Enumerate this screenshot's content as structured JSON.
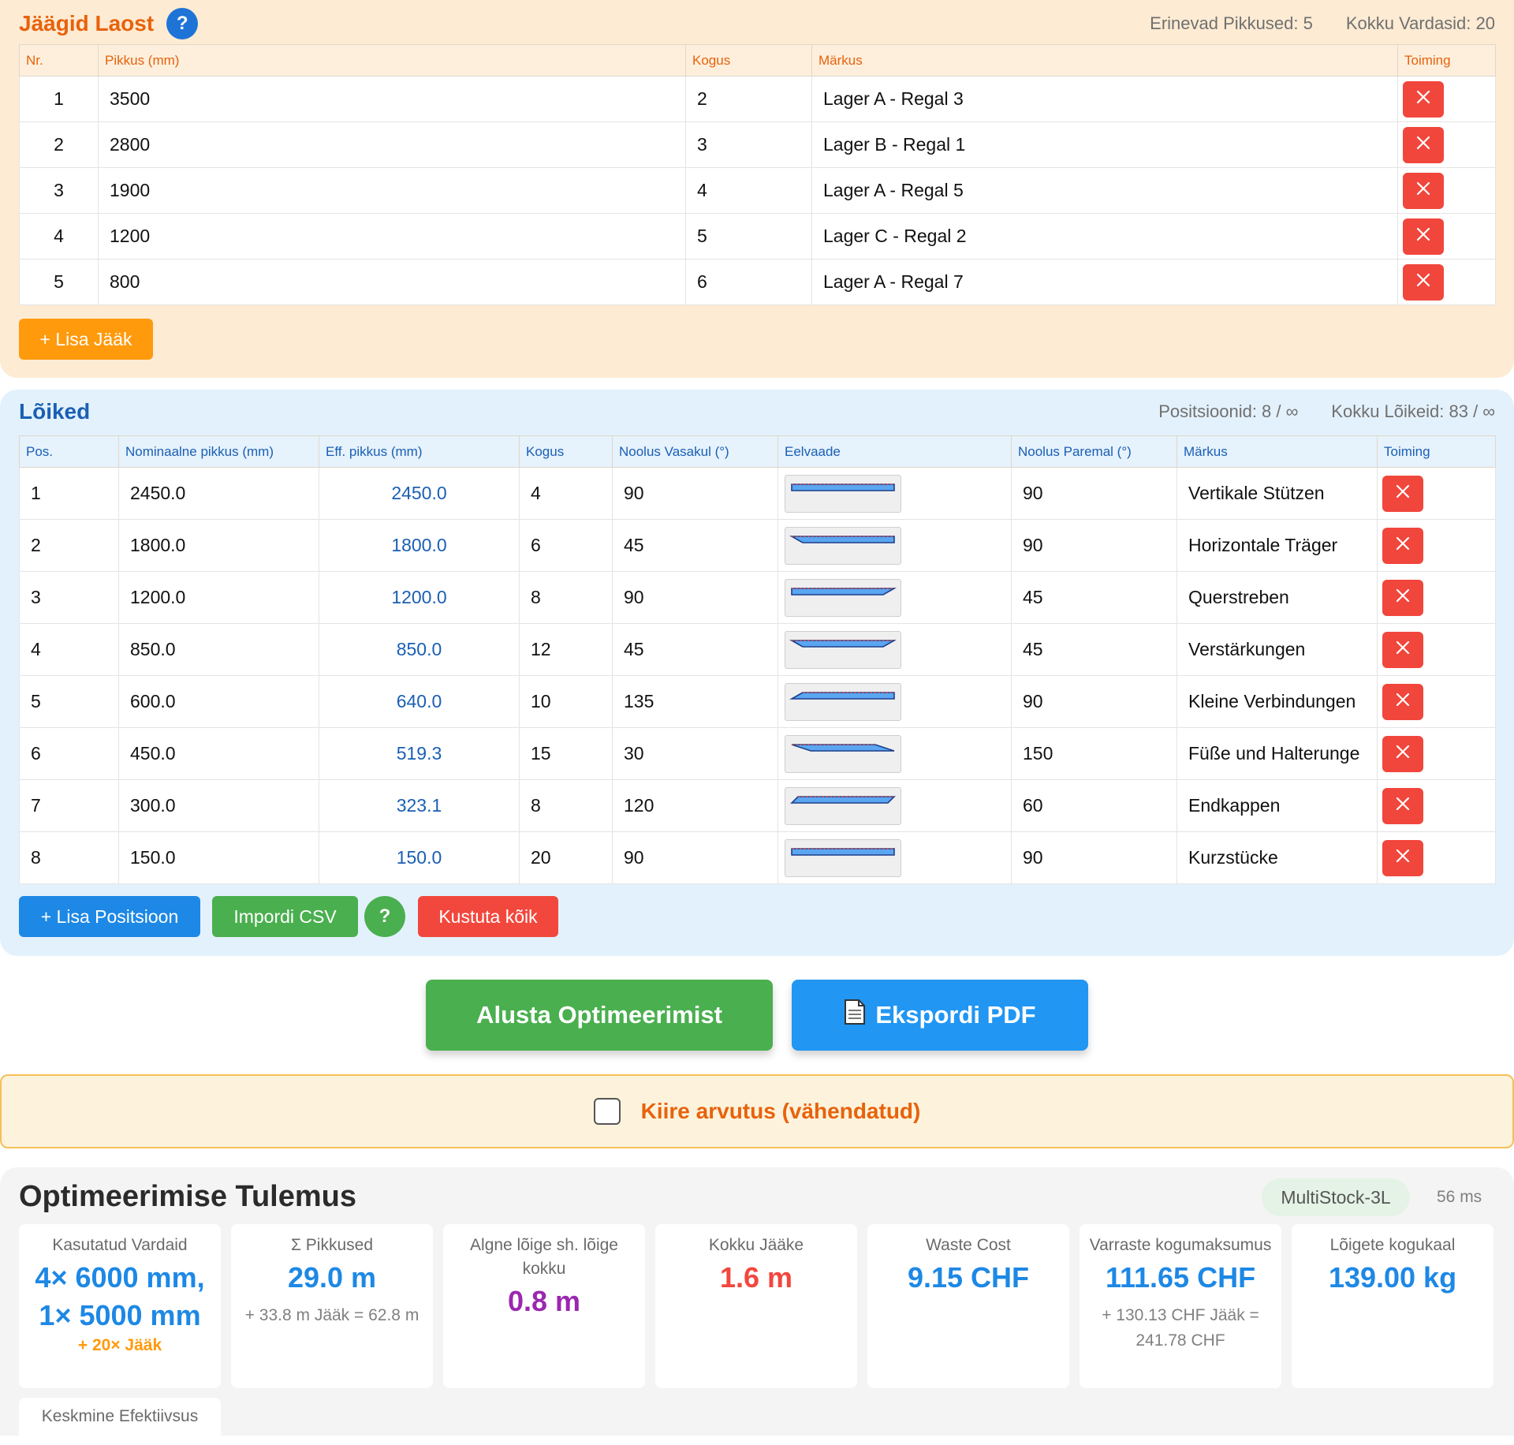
{
  "stock": {
    "title": "Jäägid Laost",
    "help": "?",
    "stat_lengths": "Erinevad Pikkused: 5",
    "stat_bars": "Kokku Vardasid: 20",
    "columns": [
      "Nr.",
      "Pikkus (mm)",
      "Kogus",
      "Märkus",
      "Toiming"
    ],
    "rows": [
      {
        "nr": "1",
        "length": "3500",
        "qty": "2",
        "note": "Lager A - Regal 3"
      },
      {
        "nr": "2",
        "length": "2800",
        "qty": "3",
        "note": "Lager B - Regal 1"
      },
      {
        "nr": "3",
        "length": "1900",
        "qty": "4",
        "note": "Lager A - Regal 5"
      },
      {
        "nr": "4",
        "length": "1200",
        "qty": "5",
        "note": "Lager C - Regal 2"
      },
      {
        "nr": "5",
        "length": "800",
        "qty": "6",
        "note": "Lager A - Regal 7"
      }
    ],
    "add_button": "+ Lisa Jääk"
  },
  "cuts": {
    "title": "Lõiked",
    "stat_positions": "Positsioonid: 8 / ∞",
    "stat_cuts": "Kokku Lõikeid: 83 / ∞",
    "columns": [
      "Pos.",
      "Nominaalne pikkus (mm)",
      "Eff. pikkus (mm)",
      "Kogus",
      "Noolus Vasakul (°)",
      "Eelvaade",
      "Noolus Paremal (°)",
      "Märkus",
      "Toiming"
    ],
    "rows": [
      {
        "pos": "1",
        "nominal": "2450.0",
        "eff": "2450.0",
        "qty": "4",
        "left": "90",
        "right": "90",
        "note": "Vertikale Stützen"
      },
      {
        "pos": "2",
        "nominal": "1800.0",
        "eff": "1800.0",
        "qty": "6",
        "left": "45",
        "right": "90",
        "note": "Horizontale Träger"
      },
      {
        "pos": "3",
        "nominal": "1200.0",
        "eff": "1200.0",
        "qty": "8",
        "left": "90",
        "right": "45",
        "note": "Querstreben"
      },
      {
        "pos": "4",
        "nominal": "850.0",
        "eff": "850.0",
        "qty": "12",
        "left": "45",
        "right": "45",
        "note": "Verstärkungen"
      },
      {
        "pos": "5",
        "nominal": "600.0",
        "eff": "640.0",
        "qty": "10",
        "left": "135",
        "right": "90",
        "note": "Kleine Verbindungen"
      },
      {
        "pos": "6",
        "nominal": "450.0",
        "eff": "519.3",
        "qty": "15",
        "left": "30",
        "right": "150",
        "note": "Füße und Halterunge"
      },
      {
        "pos": "7",
        "nominal": "300.0",
        "eff": "323.1",
        "qty": "8",
        "left": "120",
        "right": "60",
        "note": "Endkappen"
      },
      {
        "pos": "8",
        "nominal": "150.0",
        "eff": "150.0",
        "qty": "20",
        "left": "90",
        "right": "90",
        "note": "Kurzstücke"
      }
    ],
    "add_button": "+ Lisa Positsioon",
    "import_button": "Impordi CSV",
    "help": "?",
    "delete_all_button": "Kustuta kõik"
  },
  "actions": {
    "optimize_button": "Alusta Optimeerimist",
    "export_button": "Ekspordi PDF",
    "export_icon": "document-icon"
  },
  "quick_calc": {
    "label": "Kiire arvutus (vähendatud)",
    "checked": false
  },
  "results": {
    "title": "Optimeerimise Tulemus",
    "algorithm": "MultiStock-3L",
    "timing": "56 ms",
    "cards": [
      {
        "label": "Kasutatud Vardaid",
        "value": "4× 6000 mm, 1× 5000 mm",
        "extra": "+ 20× Jääk"
      },
      {
        "label": "Σ Pikkused",
        "value": "29.0 m",
        "sub": "+ 33.8 m Jääk = 62.8 m"
      },
      {
        "label": "Algne lõige sh. lõige kokku",
        "value": "0.8 m"
      },
      {
        "label": "Kokku Jääke",
        "value": "1.6 m"
      },
      {
        "label": "Waste Cost",
        "value": "9.15 CHF"
      },
      {
        "label": "Varraste kogumaksumus",
        "value": "111.65 CHF",
        "sub": "+ 130.13 CHF Jääk = 241.78 CHF"
      },
      {
        "label": "Lõigete kogukaal",
        "value": "139.00 kg"
      },
      {
        "label": "Keskmine Efektiivsus"
      }
    ]
  },
  "colors": {
    "stock_accent": "#e8620c",
    "cuts_accent": "#1a5fb4",
    "delete_red": "#f1463c",
    "green": "#4aaf4f",
    "blue": "#1d88e5",
    "orange": "#ff9a0c",
    "purple": "#9b27b0"
  }
}
